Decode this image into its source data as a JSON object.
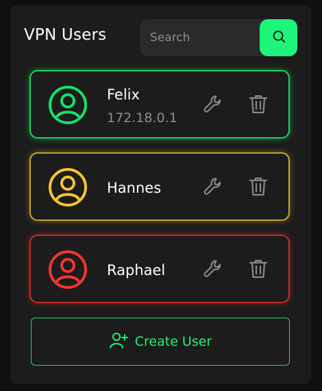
{
  "header": {
    "title": "VPN Users"
  },
  "search": {
    "placeholder": "Search",
    "value": "",
    "button_icon": "search-icon"
  },
  "users": [
    {
      "name": "Felix",
      "ip": "172.18.0.1",
      "status_color": "#14d562",
      "avatar_icon": "user-circle-icon",
      "edit_icon": "wrench-icon",
      "delete_icon": "trash-icon"
    },
    {
      "name": "Hannes",
      "status_color": "#f0c330",
      "avatar_icon": "user-circle-icon",
      "edit_icon": "wrench-icon",
      "delete_icon": "trash-icon"
    },
    {
      "name": "Raphael",
      "status_color": "#ef3530",
      "avatar_icon": "user-circle-icon",
      "edit_icon": "wrench-icon",
      "delete_icon": "trash-icon"
    }
  ],
  "actions": {
    "create_label": "Create User",
    "create_icon": "user-plus-icon"
  },
  "colors": {
    "accent": "#1ff47a",
    "panel": "#1c1c1c",
    "background": "#0f1110"
  }
}
